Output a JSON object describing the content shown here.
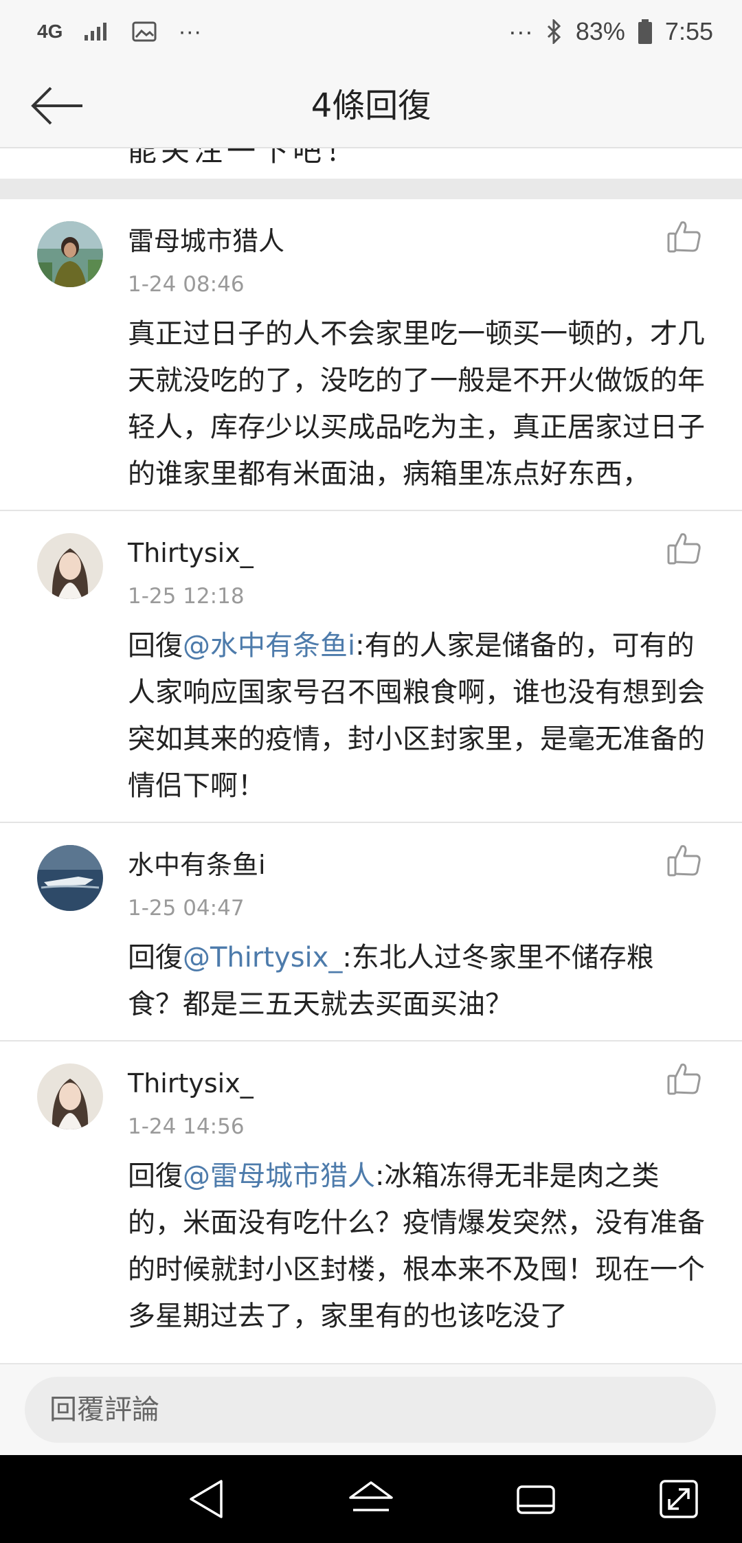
{
  "status_bar": {
    "network": "4G",
    "more_left": "···",
    "more_right": "···",
    "battery": "83%",
    "time": "7:55"
  },
  "header": {
    "title": "4條回復"
  },
  "previous_comment": {
    "partial_text": "能关注一下吧！"
  },
  "comments": [
    {
      "user": "雷母城市猎人",
      "time": "1-24 08:46",
      "text": "真正过日子的人不会家里吃一顿买一顿的，才几天就没吃的了，没吃的了一般是不开火做饭的年轻人，库存少以买成品吃为主，真正居家过日子的谁家里都有米面油，病箱里冻点好东西，"
    },
    {
      "user": "Thirtysix_",
      "time": "1-25 12:18",
      "reply_prefix": "回復",
      "mention": "@水中有条鱼i",
      "text": ":有的人家是储备的，可有的人家响应国家号召不囤粮食啊，谁也没有想到会突如其来的疫情，封小区封家里，是毫无准备的情侣下啊！"
    },
    {
      "user": "水中有条鱼i",
      "time": "1-25 04:47",
      "reply_prefix": "回復",
      "mention": "@Thirtysix_",
      "text": ":东北人过冬家里不储存粮食？都是三五天就去买面买油？"
    },
    {
      "user": "Thirtysix_",
      "time": "1-24 14:56",
      "reply_prefix": "回復",
      "mention": "@雷母城市猎人",
      "text": ":冰箱冻得无非是肉之类的，米面没有吃什么？疫情爆发突然，没有准备的时候就封小区封楼，根本来不及囤！现在一个多星期过去了，家里有的也该吃没了"
    }
  ],
  "reply_bar": {
    "placeholder": "回覆評論"
  },
  "colors": {
    "mention": "#4d7bab",
    "time": "#9a9a9a",
    "background": "#f2f2f2"
  },
  "icons": [
    "back-arrow-icon",
    "thumbs-up-icon",
    "nav-back-icon",
    "nav-home-icon",
    "nav-recents-icon",
    "nav-screen-icon"
  ]
}
